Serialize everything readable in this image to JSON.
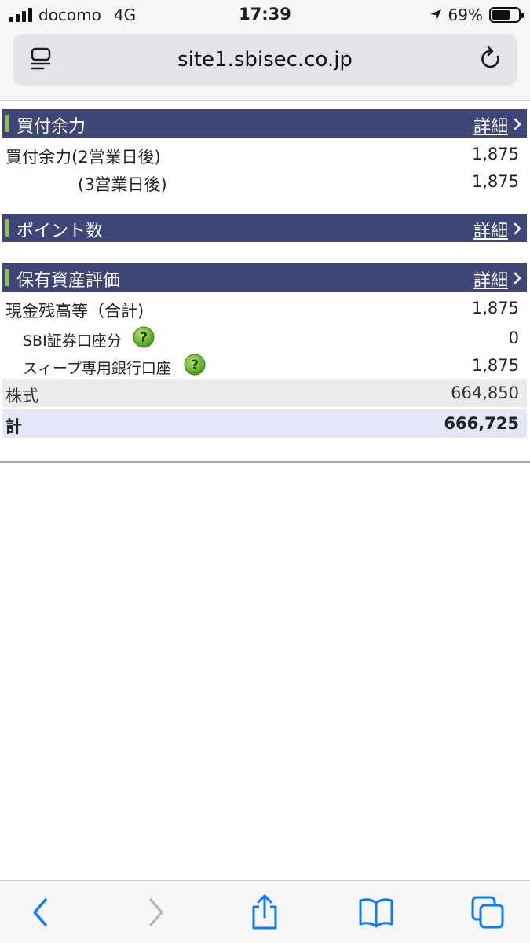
{
  "status_bar": {
    "carrier": "docomo",
    "network": "4G",
    "time": "17:39",
    "battery_percent": "69%",
    "battery_level": 0.69
  },
  "browser": {
    "url": "site1.sbisec.co.jp"
  },
  "sections": {
    "buying_power": {
      "title": "買付余力",
      "detail_label": "詳細",
      "rows": [
        {
          "label": "買付余力(2営業日後)",
          "value": "1,875"
        },
        {
          "label": "(3営業日後)",
          "value": "1,875"
        }
      ]
    },
    "points": {
      "title": "ポイント数",
      "detail_label": "詳細"
    },
    "asset_valuation": {
      "title": "保有資産評価",
      "detail_label": "詳細",
      "rows": [
        {
          "label": "現金残高等（合計)",
          "value": "1,875"
        },
        {
          "label": "SBI証券口座分",
          "value": "0"
        },
        {
          "label": "スィープ専用銀行口座",
          "value": "1,875"
        },
        {
          "label": "株式",
          "value": "664,850"
        },
        {
          "label": "計",
          "value": "666,725"
        }
      ]
    }
  },
  "colors": {
    "header_bg": "#3e4577",
    "header_accent": "#8cc63f",
    "total_row_bg": "#e6e6fa",
    "stock_row_bg": "#ebebeb",
    "ios_blue": "#0a7aff"
  },
  "icons": {
    "reader": "reader-mode-icon",
    "reload": "reload-icon",
    "help": "help-question-icon",
    "back": "back-chevron-icon",
    "forward": "forward-chevron-icon",
    "share": "share-icon",
    "bookmarks": "bookmarks-icon",
    "tabs": "tabs-icon"
  }
}
